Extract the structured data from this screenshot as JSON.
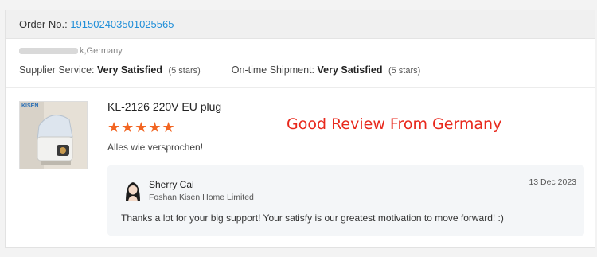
{
  "order": {
    "label": "Order No.:",
    "number": "191502403501025565"
  },
  "buyer": {
    "location_suffix": "k,Germany"
  },
  "ratings": {
    "supplier_label": "Supplier Service:",
    "supplier_value": "Very Satisfied",
    "supplier_note": "(5 stars)",
    "shipment_label": "On-time Shipment:",
    "shipment_value": "Very Satisfied",
    "shipment_note": "(5 stars)"
  },
  "product": {
    "brand": "KISEN",
    "title": "KL-2126 220V EU plug",
    "stars": "★★★★★",
    "rating": 5,
    "review": "Alles wie versprochen!"
  },
  "overlay_title": "Good Review From Germany",
  "reply": {
    "name": "Sherry Cai",
    "company": "Foshan Kisen Home Limited",
    "date": "13 Dec 2023",
    "text": "Thanks a lot for your big support! Your satisfy is our greatest motivation to move forward! :)"
  },
  "colors": {
    "accent_link": "#1f8ed8",
    "star": "#f26522",
    "overlay": "#e8281c"
  }
}
